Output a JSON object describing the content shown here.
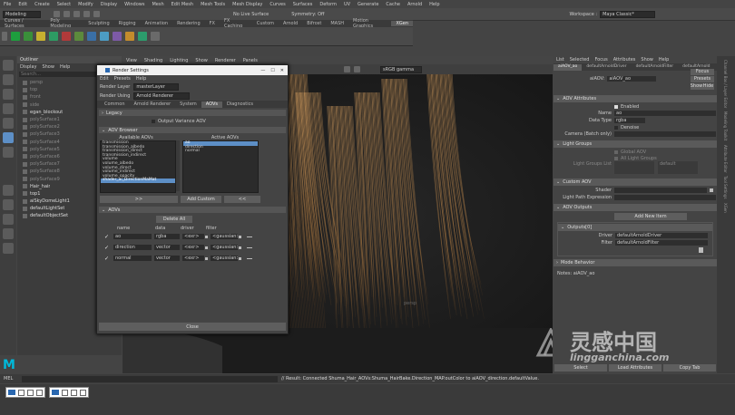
{
  "menus": [
    "File",
    "Edit",
    "Create",
    "Select",
    "Modify",
    "Display",
    "Windows",
    "Mesh",
    "Edit Mesh",
    "Mesh Tools",
    "Mesh Display",
    "Curves",
    "Surfaces",
    "Deform",
    "UV",
    "Generate",
    "Cache",
    "Arnold",
    "Help"
  ],
  "workspace": {
    "label": "Workspace :",
    "value": "Maya Classic*"
  },
  "status": {
    "mode": "Modeling",
    "live": "No Live Surface",
    "symmetry": "Symmetry: Off"
  },
  "shelf_tabs": [
    "Curves / Surfaces",
    "Poly Modeling",
    "Sculpting",
    "Rigging",
    "Animation",
    "Rendering",
    "FX",
    "FX Caching",
    "Custom",
    "Arnold",
    "Bifrost",
    "MASH",
    "Motion Graphics",
    "XGen"
  ],
  "shelf_active": "XGen",
  "outliner": {
    "title": "Outliner",
    "menu": [
      "Display",
      "Show",
      "Help"
    ],
    "search": "Search...",
    "items": [
      "persp",
      "top",
      "front",
      "side",
      "egan_blockout",
      "polySurface1",
      "polySurface2",
      "polySurface3",
      "polySurface4",
      "polySurface5",
      "polySurface6",
      "polySurface7",
      "polySurface8",
      "polySurface9",
      "Hair_hair",
      "top1",
      "aiSkyDomeLight1",
      "defaultLightSet",
      "defaultObjectSet"
    ]
  },
  "viewport": {
    "menu": [
      "View",
      "Shading",
      "Lighting",
      "Show",
      "Renderer",
      "Panels"
    ],
    "colorspace": "sRGB gamma",
    "camera": "persp",
    "watermark_cn": "灵感中国",
    "watermark_url": "lingganchina.com"
  },
  "render_settings": {
    "title": "Render Settings",
    "menu": [
      "Edit",
      "Presets",
      "Help"
    ],
    "layer_label": "Render Layer",
    "layer_value": "masterLayer",
    "using_label": "Render Using",
    "using_value": "Arnold Renderer",
    "tabs": [
      "Common",
      "Arnold Renderer",
      "System",
      "AOVs",
      "Diagnostics"
    ],
    "active_tab": "AOVs",
    "legacy": "Legacy",
    "output_variance": "Output Variance AOV",
    "aov_browser": "AOV Browser",
    "available_label": "Available AOVs",
    "active_label": "Active AOVs",
    "available": [
      "transmission",
      "transmission_albedo",
      "transmission_direct",
      "transmission_indirect",
      "volume",
      "volume_albedo",
      "volume_direct",
      "volume_indirect",
      "volume_opacity",
      "shader_ai_DirectionMaMat"
    ],
    "active": [
      "ao",
      "direction",
      "normal"
    ],
    "left_arrows": ">>",
    "add_custom": "Add Custom",
    "right_arrows": "<<",
    "aovs": "AOVs",
    "delete_all": "Delete All",
    "col_name": "name",
    "col_data": "data",
    "col_driver": "driver",
    "col_filter": "filter",
    "rows": [
      {
        "name": "ao",
        "data": "rgba",
        "driver": "<exr>",
        "filter": "<gaussian>"
      },
      {
        "name": "direction",
        "data": "vector",
        "driver": "<exr>",
        "filter": "<gaussian>"
      },
      {
        "name": "normal",
        "data": "vector",
        "driver": "<exr>",
        "filter": "<gaussian>"
      }
    ],
    "close": "Close"
  },
  "attr_editor": {
    "menu": [
      "List",
      "Selected",
      "Focus",
      "Attributes",
      "Show",
      "Help"
    ],
    "tabs": [
      "aiAOV_ao",
      "defaultArnoldDriver",
      "defaultArnoldFilter",
      "defaultArnold"
    ],
    "node_label": "aiAOV:",
    "node_value": "aiAOV_ao",
    "focus": "Focus",
    "presets": "Presets",
    "show": "Show",
    "hide": "Hide",
    "sections": {
      "attrs": "AOV Attributes",
      "light_groups": "Light Groups",
      "custom": "Custom AOV",
      "outputs": "AOV Outputs",
      "outputs0": "Outputs[0]",
      "mode": "Mode Behavior"
    },
    "enabled": "Enabled",
    "name_label": "Name",
    "name_value": "ao",
    "data_label": "Data Type",
    "data_value": "rgba",
    "denoise": "Denoise",
    "camera_label": "Camera (Batch only)",
    "global_aovs": "Global AOV",
    "all_lights": "All Light Groups",
    "light_list_label": "Light Groups List",
    "light_list_value": "default",
    "shader_label": "Shader",
    "lpe_label": "Light Path Expression",
    "add_new": "Add New Item",
    "driver_label": "Driver",
    "driver_value": "defaultArnoldDriver",
    "filter_label": "Filter",
    "filter_value": "defaultArnoldFilter",
    "notes": "Notes:  aiAOV_ao",
    "select": "Select",
    "load": "Load Attributes",
    "copy": "Copy Tab"
  },
  "cmdline": {
    "lang": "MEL",
    "result": "// Result: Connected Shuma_Hair_AOVs:Shuma_HairBake.Direction_MAP.outColor to aiAOV_direction.defaultValue."
  },
  "side_tabs": [
    "Channel Box / Layer Editor",
    "Modeling Toolkit",
    "Attribute Editor",
    "Tool Settings",
    "XGen"
  ],
  "colors": {
    "accent": "#5d8fc6",
    "hair": "#b88a55",
    "maya_logo": "#00b8d9"
  }
}
